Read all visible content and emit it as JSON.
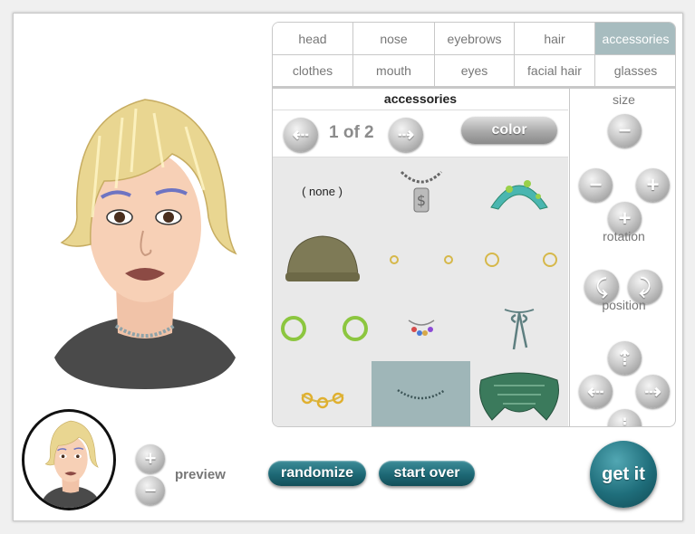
{
  "tabs": [
    {
      "label": "head",
      "active": false
    },
    {
      "label": "nose",
      "active": false
    },
    {
      "label": "eyebrows",
      "active": false
    },
    {
      "label": "hair",
      "active": false
    },
    {
      "label": "accessories",
      "active": true
    },
    {
      "label": "clothes",
      "active": false
    },
    {
      "label": "mouth",
      "active": false
    },
    {
      "label": "eyes",
      "active": false
    },
    {
      "label": "facial hair",
      "active": false
    },
    {
      "label": "glasses",
      "active": false
    }
  ],
  "section": {
    "title": "accessories"
  },
  "pager": {
    "text": "1 of 2",
    "prev_icon": "arrow-left-icon",
    "next_icon": "arrow-right-icon",
    "color_label": "color"
  },
  "accessories": {
    "none_label": "( none )",
    "items": [
      "none",
      "necklace-pendant",
      "headband",
      "beanie",
      "stud-earrings",
      "hoop-earrings-gold",
      "hoop-earrings-green",
      "charm-necklace",
      "ribbon-choker",
      "chain-bracelet",
      "bead-necklace",
      "scarf"
    ],
    "selected": "bead-necklace"
  },
  "controls": {
    "size_label": "size",
    "rotation_label": "rotation",
    "position_label": "position"
  },
  "preview": {
    "label": "preview"
  },
  "buttons": {
    "randomize": "randomize",
    "start_over": "start over",
    "get_it": "get it"
  },
  "colors": {
    "accent": "#1d6875",
    "tab_active": "#a7bcbf",
    "selected_cell": "#9fb6b8",
    "hair": "#e9d691"
  }
}
